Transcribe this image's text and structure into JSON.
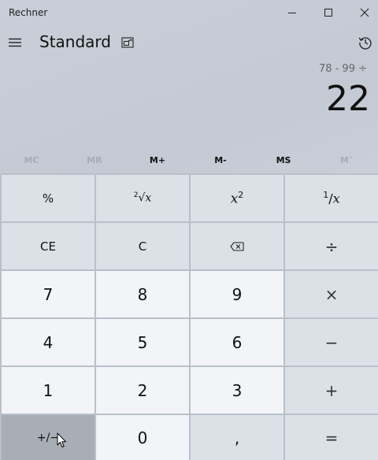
{
  "window": {
    "title": "Rechner"
  },
  "header": {
    "mode": "Standard"
  },
  "display": {
    "expression": "78 - 99 ÷",
    "value": "22"
  },
  "memory": {
    "mc": "MC",
    "mr": "MR",
    "mplus": "M+",
    "mminus": "M-",
    "ms": "MS",
    "mlist": "M˅"
  },
  "keys": {
    "percent": "%",
    "sqrt_index": "2",
    "sqrt_sym": "√",
    "sqrt_x": "x",
    "sq_x": "x",
    "sq_exp": "2",
    "recip_one": "1",
    "recip_slash": "/",
    "recip_x": "x",
    "ce": "CE",
    "c": "C",
    "divide": "÷",
    "d7": "7",
    "d8": "8",
    "d9": "9",
    "multiply": "×",
    "d4": "4",
    "d5": "5",
    "d6": "6",
    "minus": "−",
    "d1": "1",
    "d2": "2",
    "d3": "3",
    "plus": "+",
    "negate": "+/−",
    "d0": "0",
    "decimal": ",",
    "equals": "="
  }
}
